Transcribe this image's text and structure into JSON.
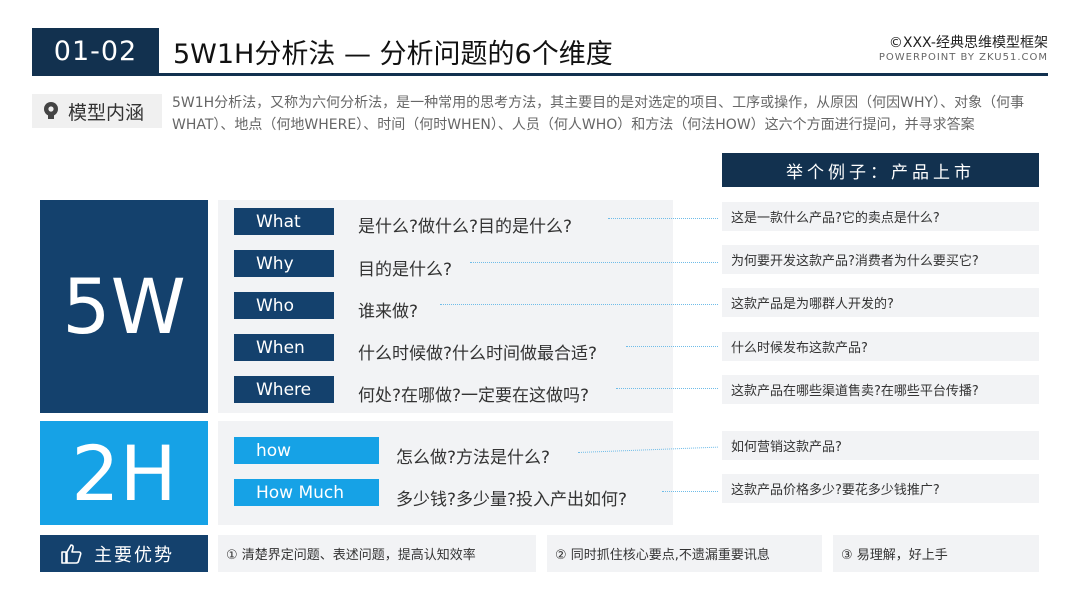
{
  "header": {
    "code": "01-02",
    "title": "5W1H分析法 — 分析问题的6个维度",
    "brand": "©XXX-经典思维模型框架",
    "sub": "POWERPOINT BY ZKU51.COM"
  },
  "intro": {
    "tag": "模型内涵",
    "text": "5W1H分析法，又称为六何分析法，是一种常用的思考方法，其主要目的是对选定的项目、工序或操作，从原因（何因WHY）、对象（何事WHAT）、地点（何地WHERE）、时间（何时WHEN）、人员（何人WHO）和方法（何法HOW）这六个方面进行提问，并寻求答案"
  },
  "example_header": "举个例子：产品上市",
  "five_w": {
    "big": "5W",
    "rows": [
      {
        "label": "What",
        "question": "是什么?做什么?目的是什么?",
        "example": "这是一款什么产品?它的卖点是什么?"
      },
      {
        "label": "Why",
        "question": "目的是什么?",
        "example": "为何要开发这款产品?消费者为什么要买它?"
      },
      {
        "label": "Who",
        "question": "谁来做?",
        "example": "这款产品是为哪群人开发的?"
      },
      {
        "label": "When",
        "question": "什么时候做?什么时间做最合适?",
        "example": "什么时候发布这款产品?"
      },
      {
        "label": "Where",
        "question": "何处?在哪做?一定要在这做吗?",
        "example": "这款产品在哪些渠道售卖?在哪些平台传播?"
      }
    ]
  },
  "two_h": {
    "big": "2H",
    "rows": [
      {
        "label": "how",
        "question": "怎么做?方法是什么?",
        "example": "如何营销这款产品?"
      },
      {
        "label": "How Much",
        "question": "多少钱?多少量?投入产出如何?",
        "example": "这款产品价格多少?要花多少钱推广?"
      }
    ]
  },
  "advantages": {
    "label": "主要优势",
    "items": [
      "① 清楚界定问题、表述问题，提高认知效率",
      "② 同时抓住核心要点,不遗漏重要讯息",
      "③ 易理解，好上手"
    ]
  },
  "colors": {
    "navy": "#14416d",
    "blue": "#16a2e6",
    "panel": "#f2f3f5"
  }
}
